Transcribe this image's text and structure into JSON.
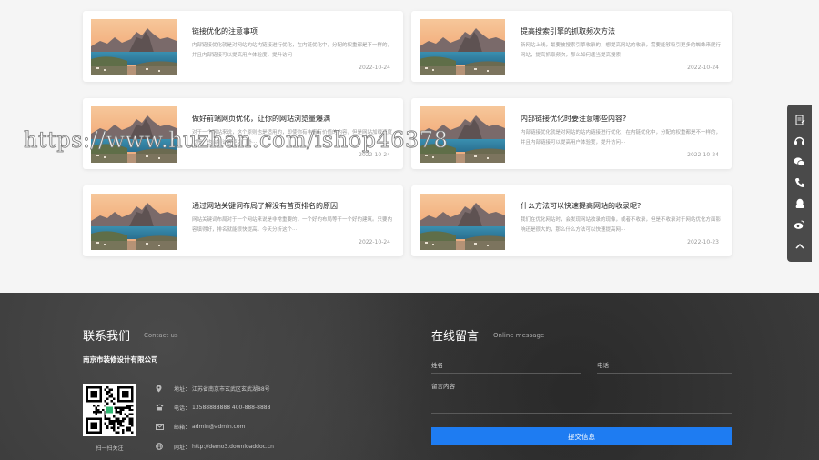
{
  "articles": [
    {
      "title": "链接优化的注意事项",
      "desc": "内部链接优化就是对网站的站内链接进行优化，在内链优化中，分配的权重都是不一样的，并且内部链接可以提高用户体验度，提升访问···",
      "date": "2022-10-24"
    },
    {
      "title": "提高搜索引擎的抓取频次方法",
      "desc": "新网站上线，最要被搜索引擎收录的，想提高网站的收录，需要能够吸引更多的蜘蛛来爬行网站，提高抓取频次，那么如何适当提高搜索···",
      "date": "2022-10-24"
    },
    {
      "title": "做好前端网页优化，让你的网站浏览量爆满",
      "desc": "对于一个网站来说，这个原则也是适用的，即使你有丰富有价值的内容，但是网站加载速度过慢，也会将访客拒之门外···",
      "date": "2022-10-24"
    },
    {
      "title": "内部链接优化时要注意哪些内容?",
      "desc": "内部链接优化就是对网站的站内链接进行优化，在内链优化中，分配的权重都是不一样的，并且内部链接可以提高用户体验度，提升访问···",
      "date": "2022-10-24"
    },
    {
      "title": "通过网站关键词布局了解没有首页排名的原因",
      "desc": "网站关键词布局对于一个网站来说是非常重要的，一个好的布局等于一个好的建筑。只要内容填得好，排名就能很快提高。今天分析这个···",
      "date": "2022-10-24"
    },
    {
      "title": "什么方法可以快速提高网站的收录呢?",
      "desc": "我们在优化网站时，会发现网站收录的现像，或者不收录，但是不收录对于网站优化方面影响还是很大的，那么什么方法可以快速提高网···",
      "date": "2022-10-23"
    }
  ],
  "watermark": "https://www.huzhan.com/ishop46378",
  "sidebar": {
    "icons": [
      "edit-icon",
      "headset-icon",
      "wechat-icon",
      "phone-icon",
      "qq-icon",
      "weibo-icon",
      "arrow-up-icon"
    ]
  },
  "contact": {
    "title": "联系我们",
    "subtitle": "Contact us",
    "company": "南京市装修设计有限公司",
    "qr_caption": "扫一扫关注",
    "address_label": "地址：",
    "address": "江苏省南京市玄武区玄武湖88号",
    "phone_label": "电话：",
    "phone": "13588888888   400-888-8888",
    "email_label": "邮箱：",
    "email": "admin@admin.com",
    "site_label": "网址：",
    "site": "http://demo3.downloaddoc.cn"
  },
  "message": {
    "title": "在线留言",
    "subtitle": "Online message",
    "name_label": "姓名",
    "phone_label": "电话",
    "content_label": "留言内容",
    "submit_label": "提交信息"
  },
  "colors": {
    "accent": "#1e7cf2",
    "footer_bg": "#3a3a3a",
    "sidebar_bg": "#4a4a4a"
  }
}
